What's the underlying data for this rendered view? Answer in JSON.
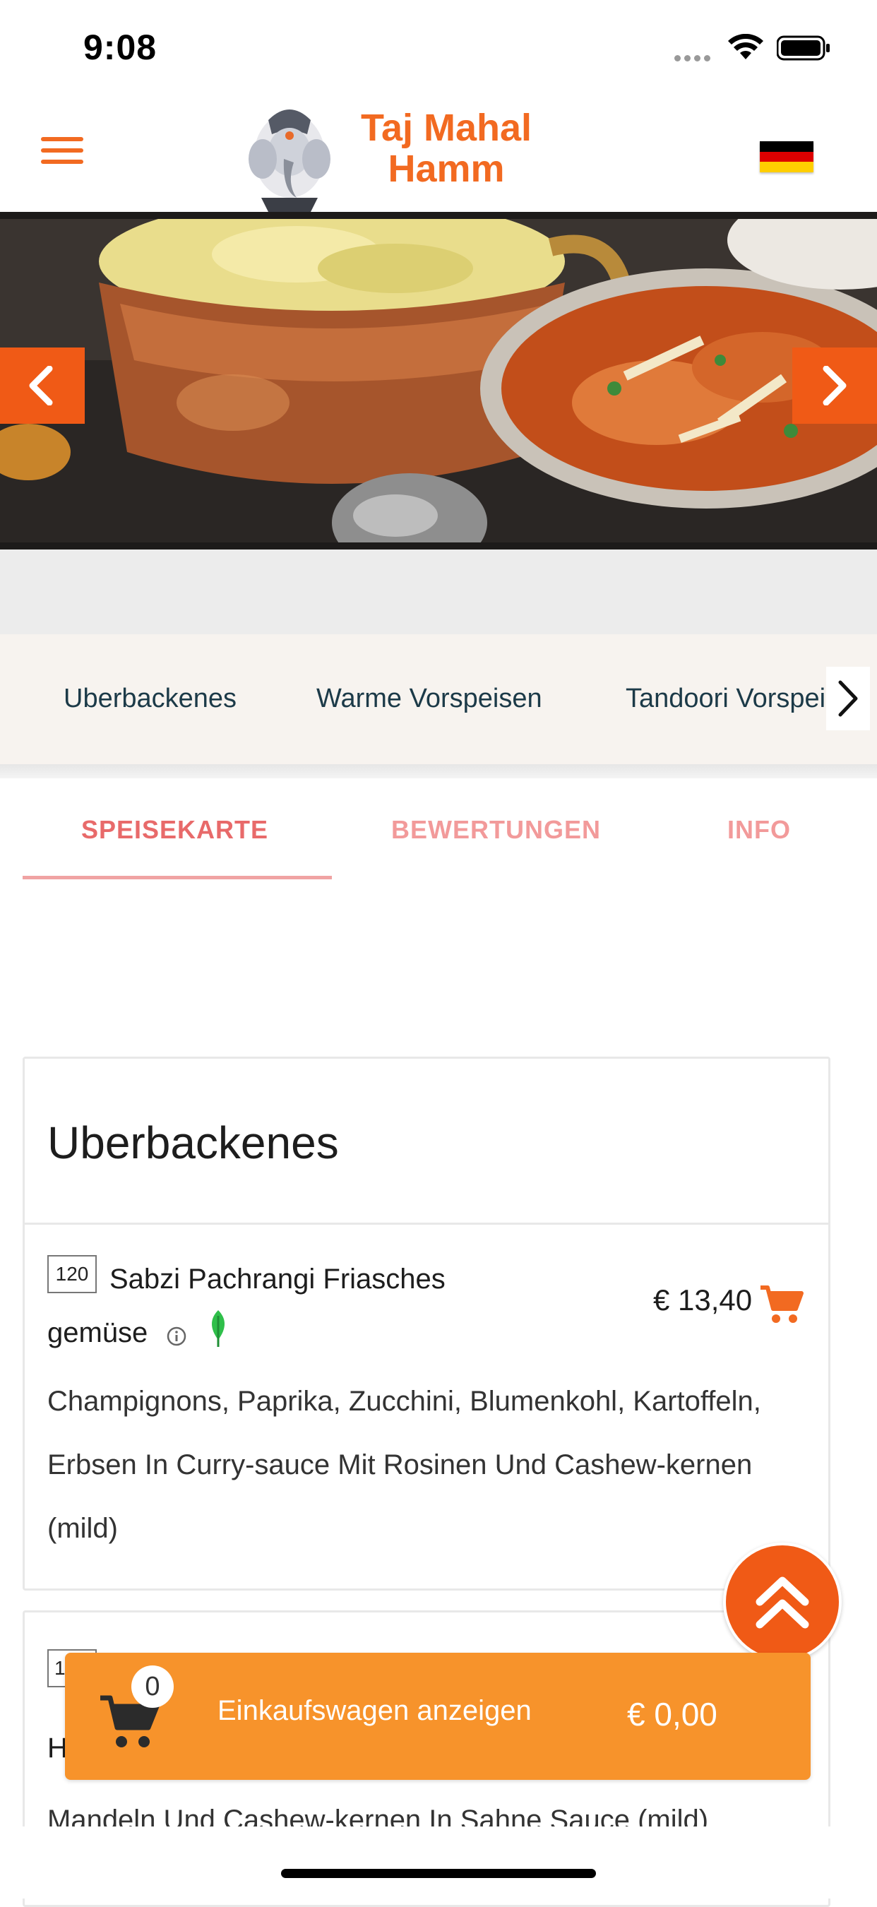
{
  "status_bar": {
    "time": "9:08"
  },
  "header": {
    "logo_line1": "Taj Mahal",
    "logo_line2": "Hamm",
    "accent_color": "#f26a21",
    "language_flag": "germany-flag"
  },
  "slider": {
    "prev_icon": "chevron-left-icon",
    "next_icon": "chevron-right-icon"
  },
  "categories": [
    "Uberbackenes",
    "Warme Vorspeisen",
    "Tandoori Vorspeisen"
  ],
  "tabs": [
    {
      "label": "SPEISEKARTE",
      "active": true
    },
    {
      "label": "BEWERTUNGEN",
      "active": false
    },
    {
      "label": "INFO",
      "active": false
    }
  ],
  "section": {
    "title": "Uberbackenes",
    "items": [
      {
        "number": "120",
        "name_line1": "Sabzi Pachrangi Friasches",
        "name_line2": "gemüse",
        "price": "€ 13,40",
        "vegetarian_icon": "leaf-icon",
        "description": "Champignons, Paprika, Zucchini, Blumenkohl, Kartoffeln, Erbsen In Curry-sauce Mit Rosinen Und Cashew-kernen (mild)"
      },
      {
        "number": "1",
        "name_partial": "H",
        "description_partial": "Mandeln Und Cashew-kernen In Sahne Sauce (mild)"
      }
    ]
  },
  "cart": {
    "count": "0",
    "label": "Einkaufswagen anzeigen",
    "total": "€ 0,00",
    "color": "#f7932b"
  }
}
